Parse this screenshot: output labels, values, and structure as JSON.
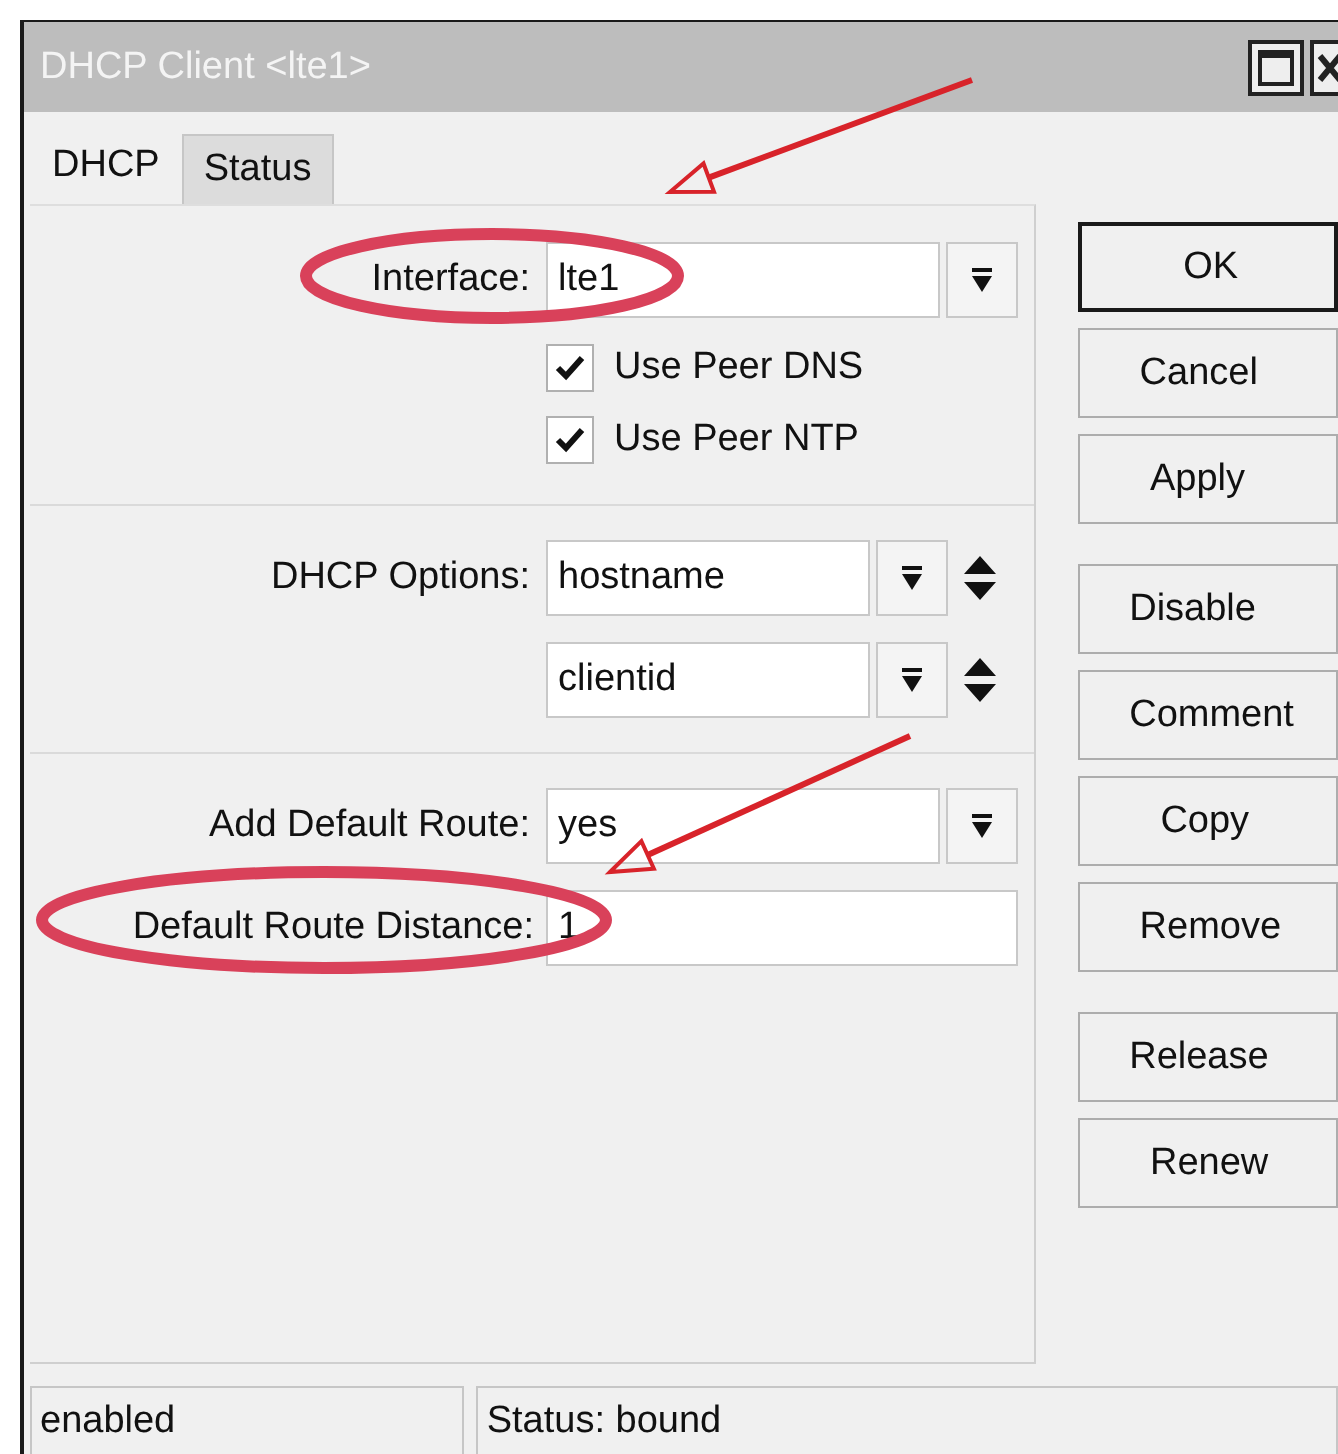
{
  "window": {
    "title": "DHCP Client <lte1>"
  },
  "tabs": [
    {
      "label": "DHCP",
      "selected": true
    },
    {
      "label": "Status",
      "selected": false
    }
  ],
  "form": {
    "interface": {
      "label": "Interface:",
      "value": "lte1"
    },
    "checkboxes": [
      {
        "label": "Use Peer DNS",
        "checked": true
      },
      {
        "label": "Use Peer NTP",
        "checked": true
      }
    ],
    "dhcp_options": {
      "label": "DHCP Options:",
      "values": [
        "hostname",
        "clientid"
      ]
    },
    "add_default_route": {
      "label": "Add Default Route:",
      "value": "yes"
    },
    "default_route_distance": {
      "label": "Default Route Distance:",
      "value": "1"
    }
  },
  "buttons": [
    {
      "label": "OK",
      "kind": "default"
    },
    {
      "label": "Cancel",
      "kind": "plain"
    },
    {
      "label": "Apply",
      "kind": "plain"
    },
    {
      "label": "Disable",
      "kind": "group"
    },
    {
      "label": "Comment",
      "kind": "plain"
    },
    {
      "label": "Copy",
      "kind": "plain"
    },
    {
      "label": "Remove",
      "kind": "plain"
    },
    {
      "label": "Release",
      "kind": "group"
    },
    {
      "label": "Renew",
      "kind": "plain"
    }
  ],
  "status_bar": [
    "enabled",
    "Status: bound"
  ]
}
